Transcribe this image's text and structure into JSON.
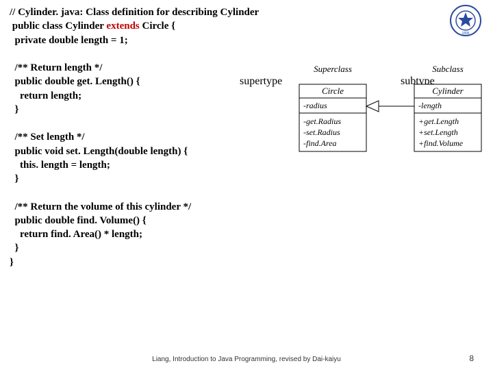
{
  "code": {
    "l1a": "// Cylinder. java: Class definition for describing Cylinder",
    "l2a": " public class Cylinder ",
    "l2b": "extends",
    "l2c": " Circle {",
    "l3": "  private double length = 1;",
    "l4": "",
    "l5": "  /** Return length */",
    "l6": "  public double get. Length() {",
    "l7": "    return length;",
    "l8": "  }",
    "l9": "",
    "l10": "  /** Set length */",
    "l11": "  public void set. Length(double length) {",
    "l12": "    this. length = length;",
    "l13": "  }",
    "l14": "",
    "l15": "  /** Return the volume of this cylinder */",
    "l16": "  public double find. Volume() {",
    "l17": "    return find. Area() * length;",
    "l18": "  }",
    "l19": "}"
  },
  "annotations": {
    "supertype": "supertype",
    "subtype": "subtype"
  },
  "uml": {
    "superclass_label": "Superclass",
    "subclass_label": "Subclass",
    "circle": {
      "name": "Circle",
      "attrs": "-radius",
      "ops1": "-get.Radius",
      "ops2": "-set.Radius",
      "ops3": "-find.Area"
    },
    "cylinder": {
      "name": "Cylinder",
      "attrs": "-length",
      "ops1": "+get.Length",
      "ops2": "+set.Length",
      "ops3": "+find.Volume"
    }
  },
  "logo": {
    "year": "1895"
  },
  "footer": "Liang, Introduction to Java Programming, revised by Dai-kaiyu",
  "page": "8"
}
